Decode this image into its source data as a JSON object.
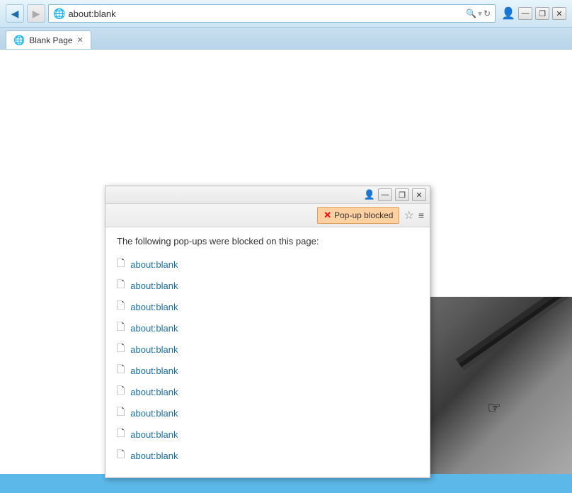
{
  "browser": {
    "back_button": "◀",
    "forward_button": "▶",
    "address_url": "about:blank",
    "tab_title": "Blank Page",
    "tab_icon": "🌐"
  },
  "toolbar": {
    "profile_icon": "👤",
    "minimize": "—",
    "restore": "❐",
    "close": "✕"
  },
  "notification_bar": {
    "badge_text": "Pop-up blocked",
    "x_icon": "✕"
  },
  "popup_panel": {
    "description": "The following pop-ups were blocked on this page:",
    "items": [
      "about:blank",
      "about:blank",
      "about:blank",
      "about:blank",
      "about:blank",
      "about:blank",
      "about:blank",
      "about:blank",
      "about:blank",
      "about:blank"
    ]
  }
}
